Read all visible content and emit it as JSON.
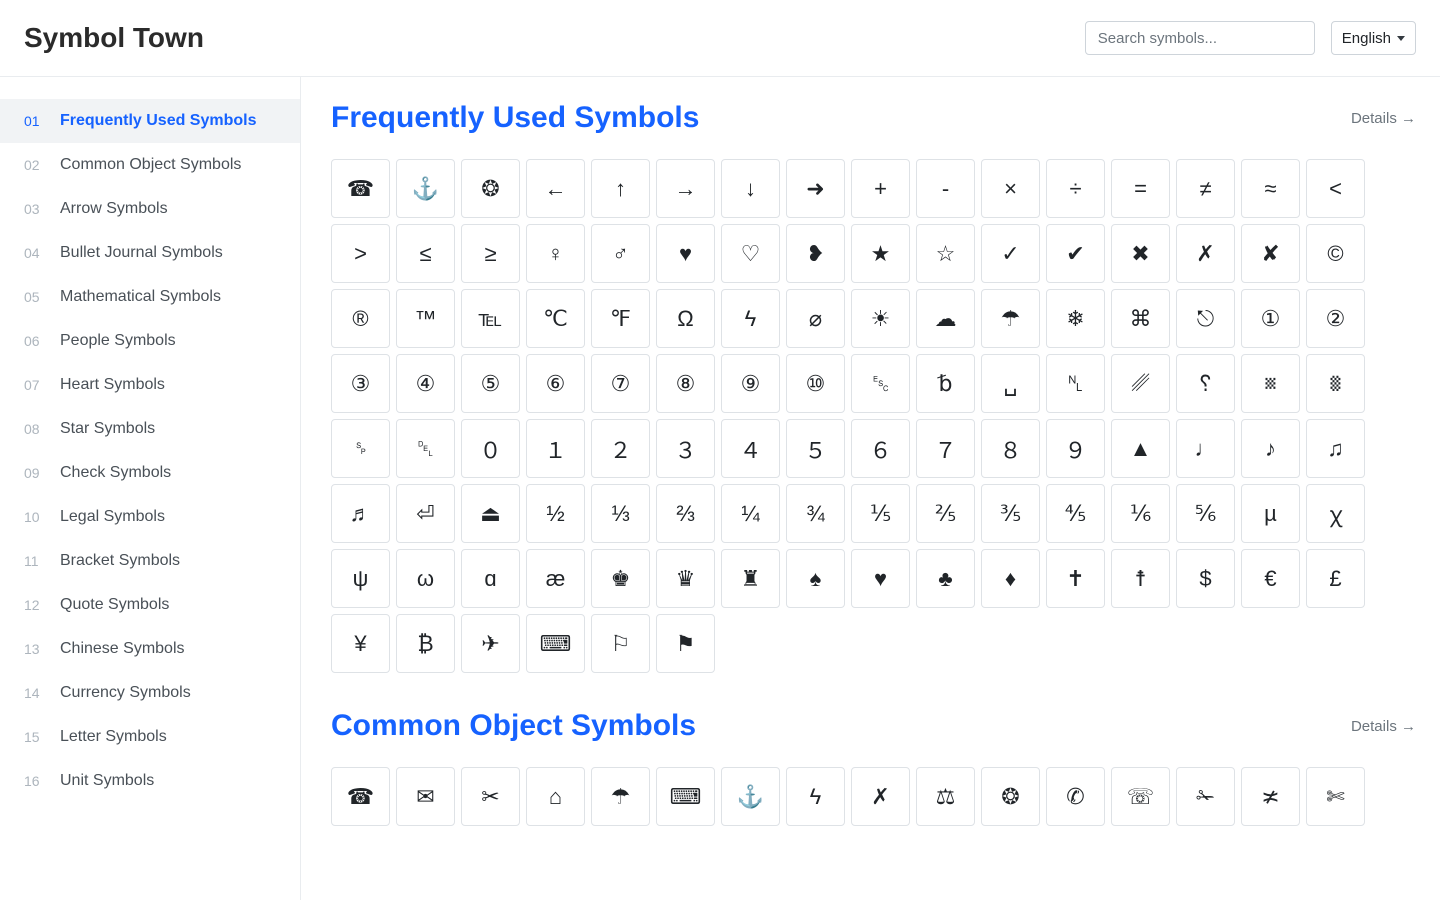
{
  "header": {
    "site_title": "Symbol Town",
    "search_placeholder": "Search symbols...",
    "language_label": "English"
  },
  "sidebar": {
    "items": [
      {
        "num": "01",
        "label": "Frequently Used Symbols",
        "active": true
      },
      {
        "num": "02",
        "label": "Common Object Symbols"
      },
      {
        "num": "03",
        "label": "Arrow Symbols"
      },
      {
        "num": "04",
        "label": "Bullet Journal Symbols"
      },
      {
        "num": "05",
        "label": "Mathematical Symbols"
      },
      {
        "num": "06",
        "label": "People Symbols"
      },
      {
        "num": "07",
        "label": "Heart Symbols"
      },
      {
        "num": "08",
        "label": "Star Symbols"
      },
      {
        "num": "09",
        "label": "Check Symbols"
      },
      {
        "num": "10",
        "label": "Legal Symbols"
      },
      {
        "num": "11",
        "label": "Bracket Symbols"
      },
      {
        "num": "12",
        "label": "Quote Symbols"
      },
      {
        "num": "13",
        "label": "Chinese Symbols"
      },
      {
        "num": "14",
        "label": "Currency Symbols"
      },
      {
        "num": "15",
        "label": "Letter Symbols"
      },
      {
        "num": "16",
        "label": "Unit Symbols"
      }
    ]
  },
  "sections": [
    {
      "id": "frequently-used",
      "title": "Frequently Used Symbols",
      "details_label": "Details →",
      "symbols": [
        "☎",
        "⚓",
        "❂",
        "←",
        "↑",
        "→",
        "↓",
        "➜",
        "+",
        "-",
        "×",
        "÷",
        "=",
        "≠",
        "≈",
        "<",
        ">",
        "≤",
        "≥",
        "♀",
        "♂",
        "♥",
        "♡",
        "❥",
        "★",
        "☆",
        "✓",
        "✔",
        "✖",
        "✗",
        "✘",
        "©",
        "®",
        "™",
        "℡",
        "℃",
        "℉",
        "Ω",
        "ϟ",
        "⌀",
        "☀",
        "☁",
        "☂",
        "❄",
        "⌘",
        "⎋",
        "①",
        "②",
        "③",
        "④",
        "⑤",
        "⑥",
        "⑦",
        "⑧",
        "⑨",
        "⑩",
        "␛",
        "␢",
        "␣",
        "␤",
        "␥",
        "␦",
        "␧",
        "␨",
        "␠",
        "␡",
        "０",
        "１",
        "２",
        "３",
        "４",
        "５",
        "６",
        "７",
        "８",
        "９",
        "▲",
        "♩",
        "♪",
        "♫",
        "♬",
        "⏎",
        "⏏",
        "½",
        "⅓",
        "⅔",
        "¼",
        "¾",
        "⅕",
        "⅖",
        "⅗",
        "⅘",
        "⅙",
        "⅚",
        "µ",
        "ꭓ",
        "ψ",
        "ω",
        "ɑ",
        "æ",
        "♚",
        "♛",
        "♜",
        "♠",
        "♥",
        "♣",
        "♦",
        "✝",
        "☨",
        "$",
        "€",
        "£",
        "¥",
        "₿",
        "✈",
        "⌨",
        "⚐",
        "⚑"
      ]
    },
    {
      "id": "common-object",
      "title": "Common Object Symbols",
      "details_label": "Details →",
      "symbols": [
        "☎",
        "✉",
        "✂",
        "⌂",
        "☂",
        "⌨",
        "⚓",
        "ϟ",
        "✗",
        "⚖",
        "❂",
        "✆",
        "☏",
        "✁",
        "≭",
        "✄"
      ]
    }
  ]
}
